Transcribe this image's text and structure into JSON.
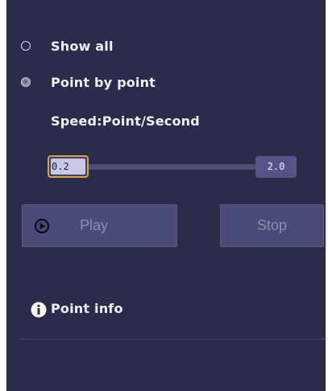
{
  "display_mode": {
    "options": [
      {
        "label": "Show all",
        "selected": false
      },
      {
        "label": "Point by point",
        "selected": true
      }
    ]
  },
  "speed": {
    "label": "Speed:Point/Second",
    "min_value": "0.2",
    "max_value": "2.0"
  },
  "controls": {
    "play_label": "Play",
    "play_icon": "play-circle-icon",
    "stop_label": "Stop"
  },
  "point_info": {
    "label": "Point info",
    "icon": "info-icon"
  },
  "colors": {
    "panel_bg": "#2b2c4c",
    "slider_focus": "#d7a53a",
    "button_bg": "#494b77",
    "button_text_disabled": "#8d8fac"
  }
}
